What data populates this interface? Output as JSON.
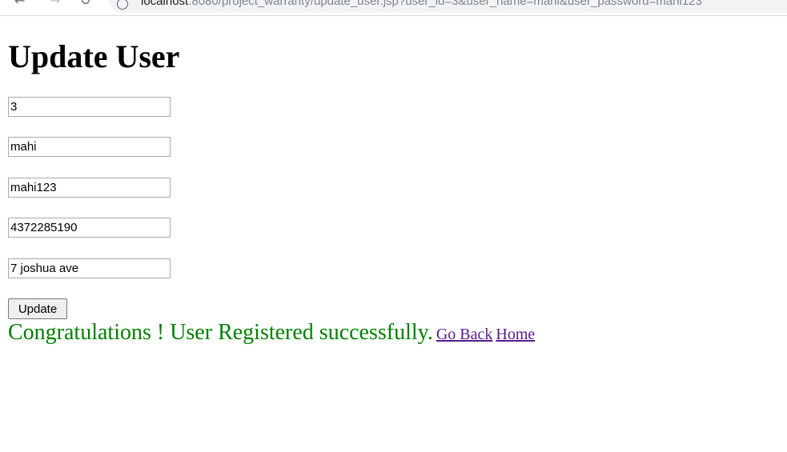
{
  "browser": {
    "url_host": "localhost",
    "url_rest": ":8080/project_warranty/update_user.jsp?user_id=3&user_name=mahi&user_password=mahi123"
  },
  "page": {
    "title": "Update User",
    "fields": [
      {
        "value": "3"
      },
      {
        "value": "mahi"
      },
      {
        "value": "mahi123"
      },
      {
        "value": "4372285190"
      },
      {
        "value": "7 joshua ave"
      }
    ],
    "update_button": "Update",
    "message": "Congratulations ! User Registered successfully.",
    "links": {
      "go_back": "Go Back",
      "home": "Home"
    }
  },
  "colors": {
    "message": "#008000",
    "link_visited": "#551a8b"
  }
}
